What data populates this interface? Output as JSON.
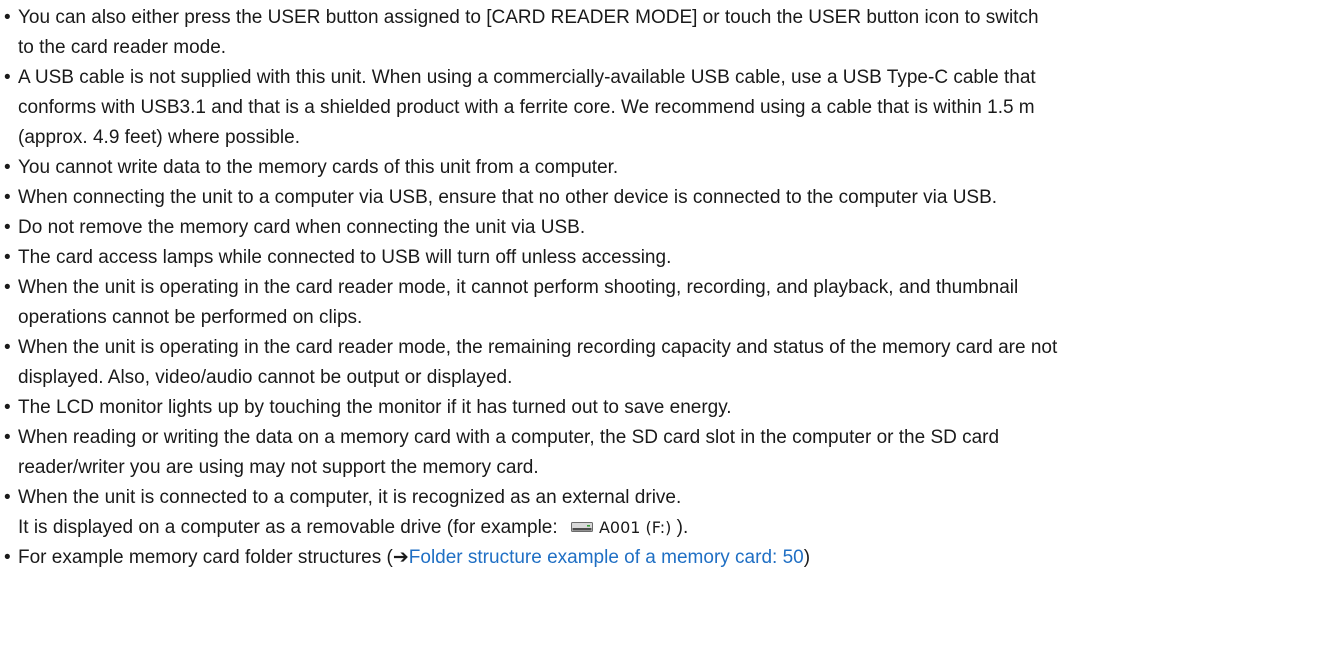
{
  "bullet_char": "•",
  "link_color": "#1f6fc4",
  "notes": [
    {
      "lines": [
        "You can also either press the USER button assigned to [CARD READER MODE] or touch the USER button icon to switch",
        "to the card reader mode."
      ]
    },
    {
      "lines": [
        "A USB cable is not supplied with this unit. When using a commercially-available USB cable, use a USB Type-C cable that",
        "conforms with USB3.1 and that is a shielded product with a ferrite core. We recommend using a cable that is within 1.5 m",
        "(approx. 4.9 feet) where possible."
      ]
    },
    {
      "lines": [
        "You cannot write data to the memory cards of this unit from a computer."
      ]
    },
    {
      "lines": [
        "When connecting the unit to a computer via USB, ensure that no other device is connected to the computer via USB."
      ]
    },
    {
      "lines": [
        "Do not remove the memory card when connecting the unit via USB."
      ]
    },
    {
      "lines": [
        "The card access lamps while connected to USB will turn off unless accessing."
      ]
    },
    {
      "lines": [
        "When the unit is operating in the card reader mode, it cannot perform shooting, recording, and playback, and thumbnail",
        "operations cannot be performed on clips."
      ]
    },
    {
      "lines": [
        "When the unit is operating in the card reader mode, the remaining recording capacity and status of the memory card are not",
        "displayed. Also, video/audio cannot be output or displayed."
      ]
    },
    {
      "lines": [
        "The LCD monitor lights up by touching the monitor if it has turned out to save energy."
      ]
    },
    {
      "lines": [
        "When reading or writing the data on a memory card with a computer, the SD card slot in the computer or the SD card",
        "reader/writer you are using may not support the memory card."
      ]
    },
    {
      "lines": [
        "When the unit is connected to a computer, it is recognized as an external drive."
      ],
      "drive_line": {
        "before": "It is displayed on a computer as a removable drive (for example: ",
        "icon": "removable-drive-icon",
        "label": "A001 (F:)",
        "after": " )."
      }
    },
    {
      "lines": [],
      "xref": {
        "before": "For example memory card folder structures (",
        "arrow": "➔",
        "link_text": "Folder structure example of a memory card: 50",
        "after": ")"
      }
    }
  ]
}
